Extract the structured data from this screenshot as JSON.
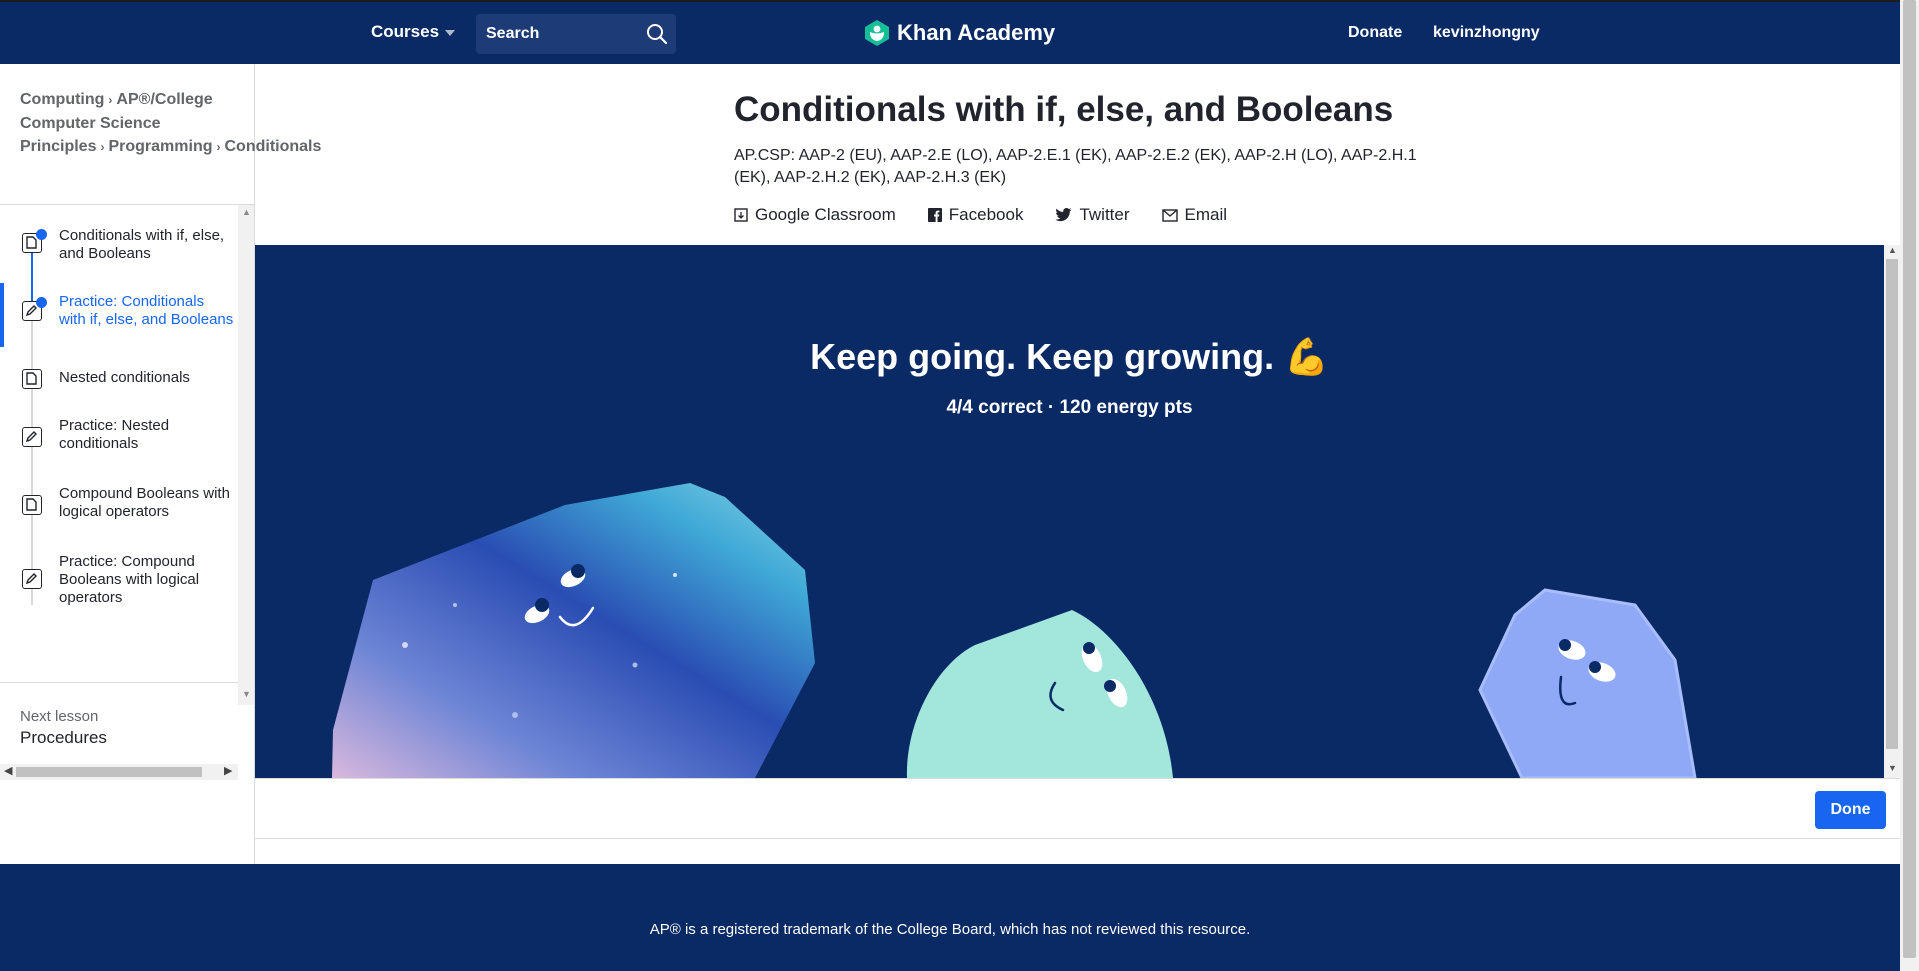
{
  "nav": {
    "courses_label": "Courses",
    "search_placeholder": "Search",
    "logo_text": "Khan Academy",
    "donate_label": "Donate",
    "user_label": "kevinzhongny"
  },
  "breadcrumb": {
    "items": [
      "Computing",
      "AP®︎/College Computer Science Principles",
      "Programming",
      "Conditionals"
    ]
  },
  "sidebar": {
    "items": [
      {
        "label": "Conditionals with if, else, and Booleans",
        "type": "article",
        "completed": true
      },
      {
        "label": "Practice: Conditionals with if, else, and Booleans",
        "type": "exercise",
        "completed": true,
        "active": true
      },
      {
        "label": "Nested conditionals",
        "type": "article",
        "completed": false
      },
      {
        "label": "Practice: Nested conditionals",
        "type": "exercise",
        "completed": false
      },
      {
        "label": "Compound Booleans with logical operators",
        "type": "article",
        "completed": false
      },
      {
        "label": "Practice: Compound Booleans with logical operators",
        "type": "exercise",
        "completed": false
      }
    ],
    "next_lesson_label": "Next lesson",
    "next_lesson_title": "Procedures"
  },
  "content": {
    "title": "Conditionals with if, else, and Booleans",
    "standards": "AP.CSP: AAP‑2 (EU), AAP‑2.E (LO), AAP‑2.E.1 (EK), AAP‑2.E.2 (EK), AAP‑2.H (LO), AAP‑2.H.1 (EK), AAP‑2.H.2 (EK), AAP‑2.H.3 (EK)",
    "share": {
      "google_classroom": "Google Classroom",
      "facebook": "Facebook",
      "twitter": "Twitter",
      "email": "Email"
    }
  },
  "exercise": {
    "headline": "Keep going. Keep growing. 💪",
    "score": "4/4 correct · 120 energy pts",
    "done_label": "Done"
  },
  "footer": {
    "trademark": "AP® is a registered trademark of the College Board, which has not reviewed this resource."
  },
  "colors": {
    "nav_bg": "#0a2a66",
    "accent": "#1865f2",
    "mint_character": "#a3e6dc",
    "periwinkle_character": "#8fa9f7"
  }
}
